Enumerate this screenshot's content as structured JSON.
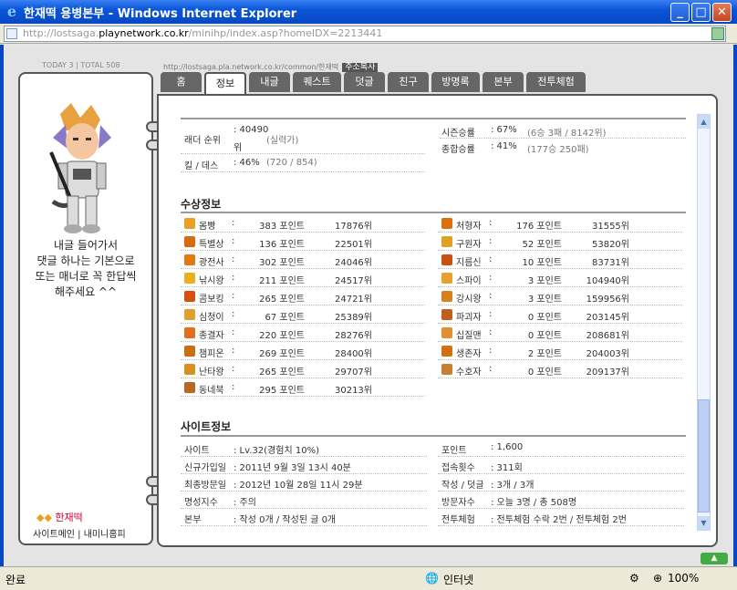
{
  "window": {
    "title": "한재떡 용병본부 - Windows Internet Explorer"
  },
  "address": {
    "url_prefix": "http://lostsaga.",
    "url_host": "playnetwork.co.kr",
    "url_path": "/minihp/index.asp?homeIDX=2213441"
  },
  "top": {
    "counts": "TODAY 3 | TOTAL 508",
    "small_url": "http://lostsaga.pla.network.co.kr/common/한재떡",
    "copy_label": "주소복사"
  },
  "profile": {
    "intro_lines": [
      "내글 들어가서",
      "댓글 하나는 기본으로",
      "또는 매너로 꼭 한답씩",
      "해주세요 ^^"
    ],
    "owner": "한재떡",
    "links": "사이트메인 | 내미니홈피"
  },
  "tabs": [
    "홈",
    "정보",
    "내글",
    "퀘스트",
    "덧글",
    "친구",
    "방명록",
    "본부",
    "전투체험"
  ],
  "stats": {
    "ladder_label": "래더 순위",
    "ladder_value": ": 40490",
    "ladder_unit": "위",
    "ladder_grade": "(실력가)",
    "kd_label": "킬 / 데스",
    "kd_value": ": 46%",
    "kd_detail": "(720 / 854)",
    "season_label": "시즌승률",
    "season_value": ": 67%",
    "season_detail": "(6승 3패 / 8142위)",
    "total_label": "종합승률",
    "total_value": ": 41%",
    "total_detail": "(177승 250패)"
  },
  "awards": {
    "title": "수상정보",
    "left": [
      {
        "name": "몸빵",
        "colon": ":",
        "points": "383 포인트",
        "rank": "17876위",
        "icon_color": "#e8a020"
      },
      {
        "name": "특별상",
        "colon": ":",
        "points": "136 포인트",
        "rank": "22501위",
        "icon_color": "#d86a10"
      },
      {
        "name": "광전사",
        "colon": ":",
        "points": "302 포인트",
        "rank": "24046위",
        "icon_color": "#e07a10"
      },
      {
        "name": "낚시왕",
        "colon": ":",
        "points": "211 포인트",
        "rank": "24517위",
        "icon_color": "#e8b020"
      },
      {
        "name": "콤보킹",
        "colon": ":",
        "points": "265 포인트",
        "rank": "24721위",
        "icon_color": "#d85010"
      },
      {
        "name": "심청이",
        "colon": ":",
        "points": "67 포인트",
        "rank": "25389위",
        "icon_color": "#e0a030"
      },
      {
        "name": "종결자",
        "colon": ":",
        "points": "220 포인트",
        "rank": "28276위",
        "icon_color": "#e07020"
      },
      {
        "name": "챔피온",
        "colon": ":",
        "points": "269 포인트",
        "rank": "28400위",
        "icon_color": "#c87010"
      },
      {
        "name": "난타왕",
        "colon": ":",
        "points": "265 포인트",
        "rank": "29707위",
        "icon_color": "#d89020"
      },
      {
        "name": "동네북",
        "colon": ":",
        "points": "295 포인트",
        "rank": "30213위",
        "icon_color": "#b86820"
      }
    ],
    "right": [
      {
        "name": "처형자",
        "colon": ":",
        "points": "176 포인트",
        "rank": "31555위",
        "icon_color": "#d87010"
      },
      {
        "name": "구원자",
        "colon": ":",
        "points": "52 포인트",
        "rank": "53820위",
        "icon_color": "#e0a020"
      },
      {
        "name": "지름신",
        "colon": ":",
        "points": "10 포인트",
        "rank": "83731위",
        "icon_color": "#c85010"
      },
      {
        "name": "스파이",
        "colon": ":",
        "points": "3 포인트",
        "rank": "104940위",
        "icon_color": "#e8a030"
      },
      {
        "name": "강시왕",
        "colon": ":",
        "points": "3 포인트",
        "rank": "159956위",
        "icon_color": "#d88020"
      },
      {
        "name": "파괴자",
        "colon": ":",
        "points": "0 포인트",
        "rank": "203145위",
        "icon_color": "#c06020"
      },
      {
        "name": "십질맨",
        "colon": ":",
        "points": "0 포인트",
        "rank": "208681위",
        "icon_color": "#e09030"
      },
      {
        "name": "생존자",
        "colon": ":",
        "points": "2 포인트",
        "rank": "204003위",
        "icon_color": "#d07010"
      },
      {
        "name": "수호자",
        "colon": ":",
        "points": "0 포인트",
        "rank": "209137위",
        "icon_color": "#c88030"
      }
    ]
  },
  "site": {
    "title": "사이트정보",
    "left": [
      {
        "label": "사이트",
        "value": ": Lv.32(경험치 10%)"
      },
      {
        "label": "신규가입일",
        "value": ": 2011년 9월 3일 13시 40분"
      },
      {
        "label": "최종방문일",
        "value": ": 2012년 10월 28일 11시 29분"
      },
      {
        "label": "명성지수",
        "value": ": 주의"
      },
      {
        "label": "본부",
        "value": ": 작성 0개 / 작성된 글 0개"
      }
    ],
    "right": [
      {
        "label": "포인트",
        "value": ": 1,600"
      },
      {
        "label": "접속횟수",
        "value": ": 311회"
      },
      {
        "label": "작성 / 덧글",
        "value": ": 3개 / 3개"
      },
      {
        "label": "방문자수",
        "value": ": 오늘 3명 / 총 508명"
      },
      {
        "label": "전투체험",
        "value": ": 전투체험 수락 2번 / 전투체험 2번"
      }
    ]
  },
  "status": {
    "left": "완료",
    "zone": "인터넷",
    "zoom": "100%"
  }
}
